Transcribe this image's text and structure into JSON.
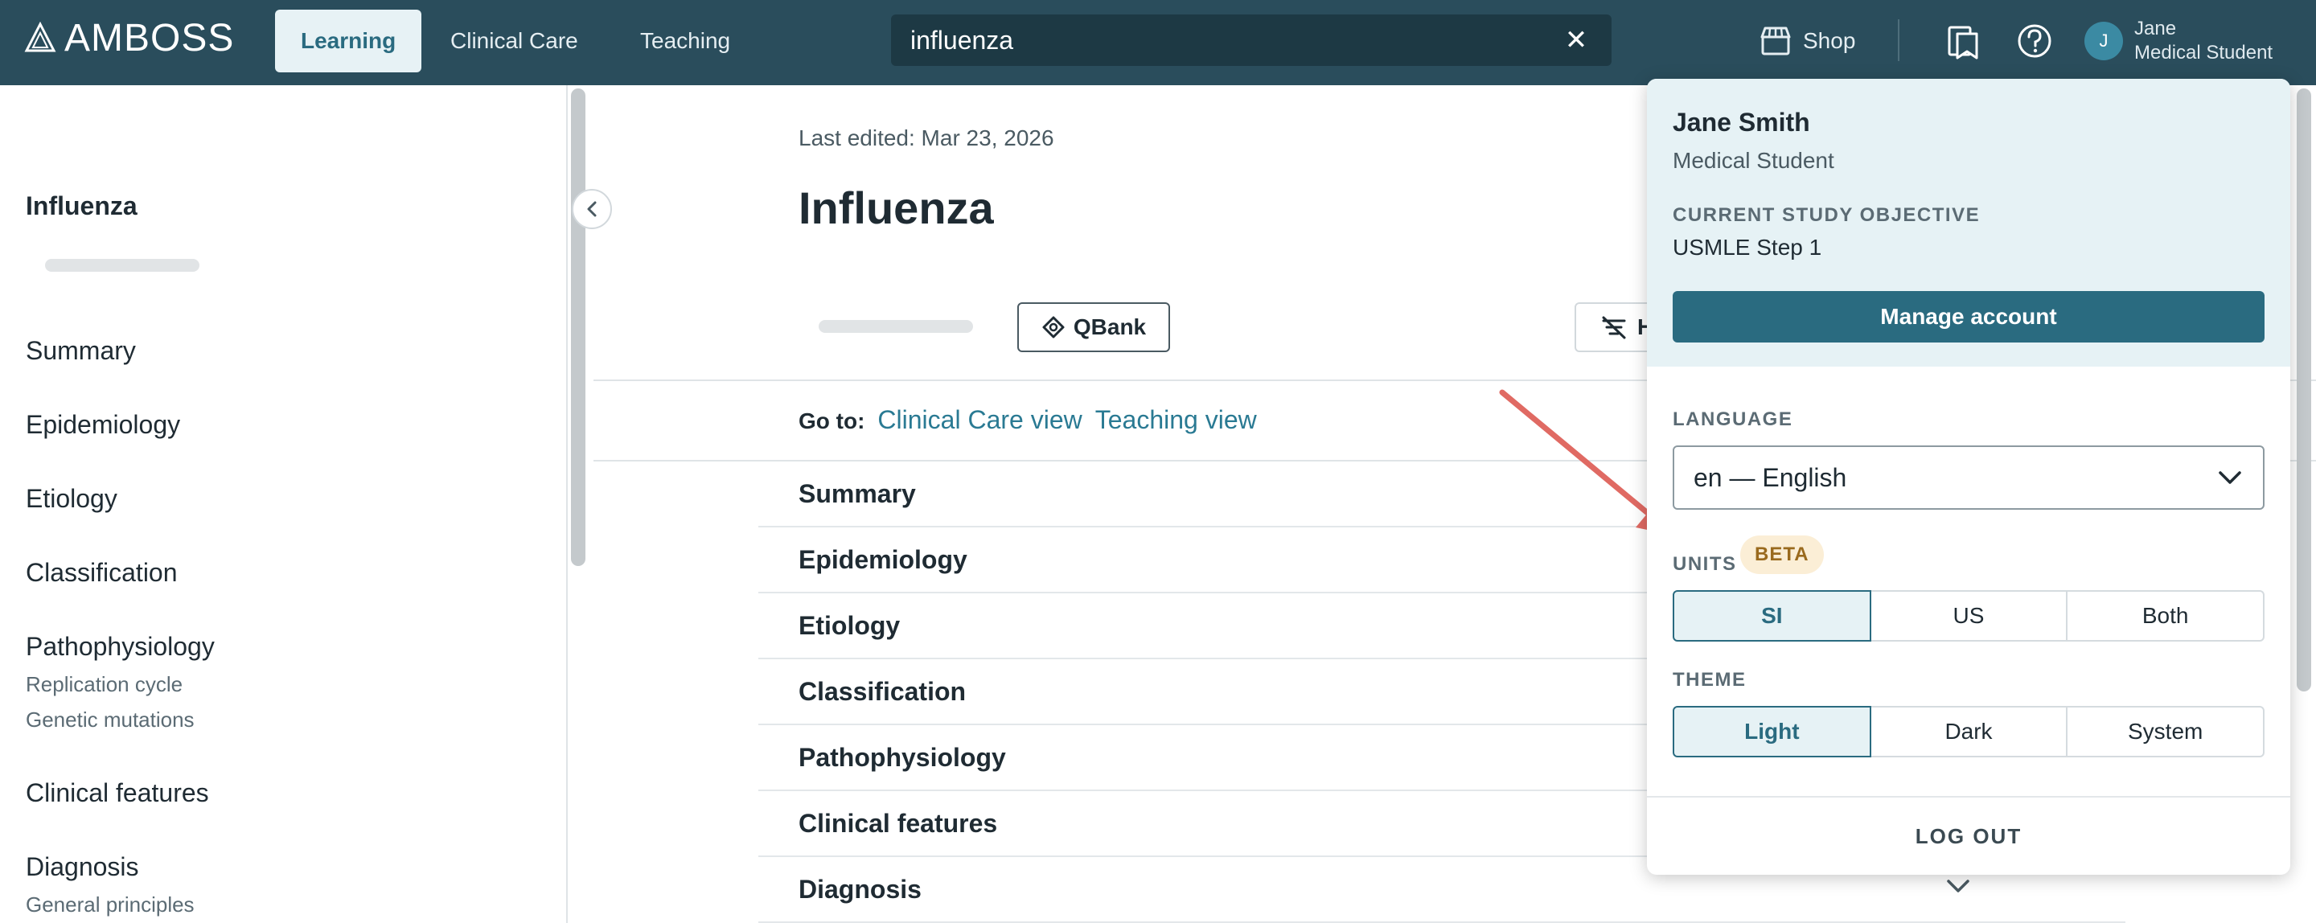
{
  "header": {
    "logo_text": "AMBOSS",
    "tabs": [
      {
        "label": "Learning",
        "active": true
      },
      {
        "label": "Clinical Care",
        "active": false
      },
      {
        "label": "Teaching",
        "active": false
      }
    ],
    "search": {
      "value": "influenza",
      "clear_icon": "close-icon"
    },
    "shop_label": "Shop",
    "user": {
      "avatar_initial": "J",
      "name": "Jane",
      "role": "Medical Student"
    }
  },
  "sidebar": {
    "title": "Influenza",
    "items": [
      {
        "label": "Summary"
      },
      {
        "label": "Epidemiology"
      },
      {
        "label": "Etiology"
      },
      {
        "label": "Classification"
      },
      {
        "label": "Pathophysiology",
        "subitems": [
          "Replication cycle",
          "Genetic mutations"
        ]
      },
      {
        "label": "Clinical features"
      },
      {
        "label": "Diagnosis",
        "subitems": [
          "General principles"
        ]
      }
    ]
  },
  "article": {
    "last_edited": "Last edited: Mar 23, 2026",
    "title": "Influenza",
    "qbank_label": "QBank",
    "filter_label": "H",
    "goto_label": "Go to:",
    "goto_links": [
      "Clinical Care view",
      "Teaching view"
    ],
    "sections": [
      "Summary",
      "Epidemiology",
      "Etiology",
      "Classification",
      "Pathophysiology",
      "Clinical features",
      "Diagnosis"
    ]
  },
  "account_panel": {
    "name": "Jane Smith",
    "role": "Medical Student",
    "objective_caption": "CURRENT STUDY OBJECTIVE",
    "objective": "USMLE Step 1",
    "manage_label": "Manage account",
    "language_caption": "LANGUAGE",
    "language_value": "en — English",
    "units_caption": "UNITS",
    "beta_label": "BETA",
    "units_options": [
      "SI",
      "US",
      "Both"
    ],
    "units_selected": "SI",
    "theme_caption": "THEME",
    "theme_options": [
      "Light",
      "Dark",
      "System"
    ],
    "theme_selected": "Light",
    "logout_label": "LOG OUT"
  },
  "colors": {
    "topbar": "#2a4d5c",
    "accent": "#2a6b80",
    "panel_header": "#e6f2f5",
    "beta_bg": "#fbeed6",
    "annotation_arrow": "#e06a63"
  }
}
